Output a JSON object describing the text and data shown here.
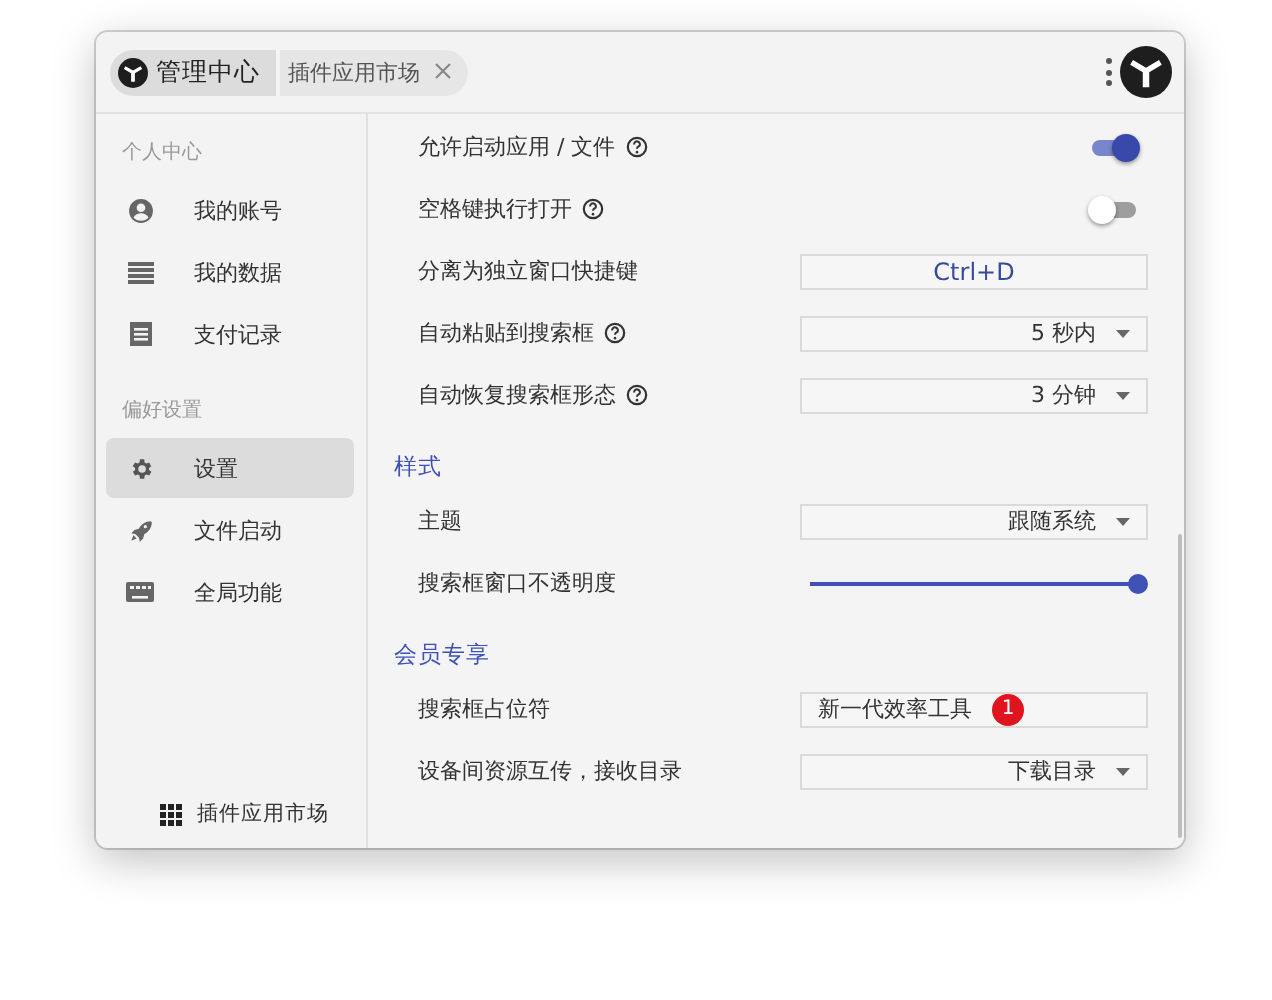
{
  "tabs": [
    {
      "label": "管理中心",
      "selected": true
    },
    {
      "label": "插件应用市场",
      "selected": false
    }
  ],
  "sidebar": {
    "sections": [
      {
        "title": "个人中心",
        "items": [
          {
            "label": "我的账号",
            "selected": false
          },
          {
            "label": "我的数据",
            "selected": false
          },
          {
            "label": "支付记录",
            "selected": false
          }
        ]
      },
      {
        "title": "偏好设置",
        "items": [
          {
            "label": "设置",
            "selected": true
          },
          {
            "label": "文件启动",
            "selected": false
          },
          {
            "label": "全局功能",
            "selected": false
          }
        ]
      }
    ],
    "footer": "插件应用市场"
  },
  "settings": [
    {
      "items": [
        {
          "kind": "toggle",
          "label": "允许启动应用 / 文件",
          "help": true,
          "on": true
        },
        {
          "kind": "toggle",
          "label": "空格键执行打开",
          "help": true,
          "on": false
        },
        {
          "kind": "shortcut",
          "label": "分离为独立窗口快捷键",
          "help": false,
          "value": "Ctrl+D"
        },
        {
          "kind": "select",
          "label": "自动粘贴到搜索框",
          "help": true,
          "value": "5 秒内"
        },
        {
          "kind": "select",
          "label": "自动恢复搜索框形态",
          "help": true,
          "value": "3 分钟"
        }
      ]
    },
    {
      "title": "样式",
      "items": [
        {
          "kind": "select",
          "label": "主题",
          "help": false,
          "value": "跟随系统"
        },
        {
          "kind": "slider",
          "label": "搜索框窗口不透明度",
          "help": false,
          "level": 1
        }
      ]
    },
    {
      "title": "会员专享",
      "items": [
        {
          "kind": "text",
          "label": "搜索框占位符",
          "help": false,
          "value": "新一代效率工具",
          "badge": "1"
        },
        {
          "kind": "select",
          "label": "设备间资源互传，接收目录",
          "help": false,
          "value": "下载目录"
        }
      ]
    }
  ]
}
